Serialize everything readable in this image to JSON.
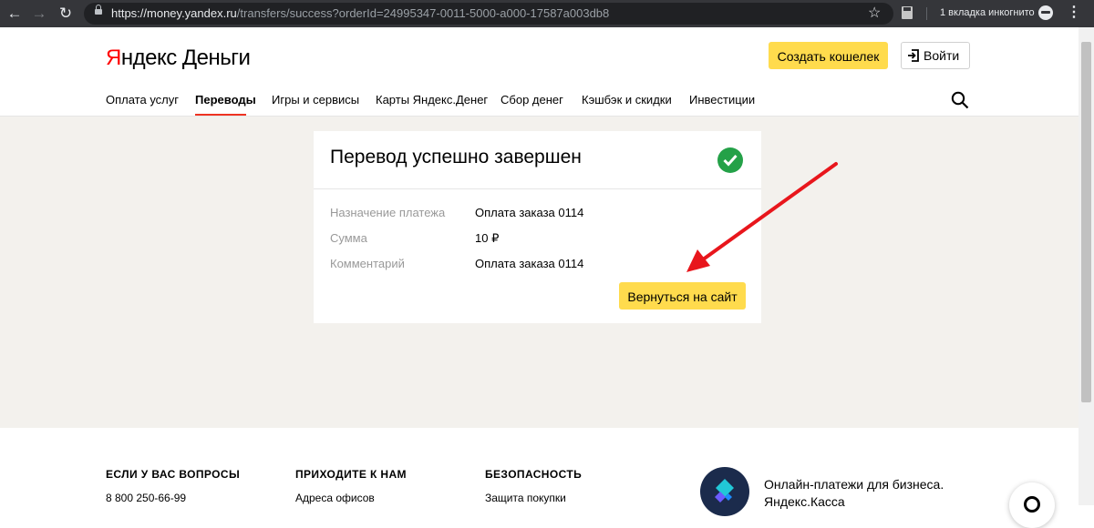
{
  "browser": {
    "url_host": "https://money.yandex.ru",
    "url_path": "/transfers/success?orderId=24995347-0011-5000-a000-17587a003db8",
    "incognito_label": "1 вкладка инкогнито"
  },
  "header": {
    "logo_y": "Я",
    "logo_rest": "ндекс Деньги",
    "create_wallet": "Создать кошелек",
    "login": "Войти",
    "nav": [
      "Оплата услуг",
      "Переводы",
      "Игры и сервисы",
      "Карты Яндекс.Денег",
      "Сбор денег",
      "Кэшбэк и скидки",
      "Инвестиции"
    ],
    "active_nav": "Переводы"
  },
  "card": {
    "title": "Перевод успешно завершен",
    "rows": [
      {
        "label": "Назначение платежа",
        "value": "Оплата заказа 0114"
      },
      {
        "label": "Сумма",
        "value": "10 ₽"
      },
      {
        "label": "Комментарий",
        "value": "Оплата заказа 0114"
      }
    ],
    "back_button": "Вернуться на сайт"
  },
  "footer": {
    "columns": [
      {
        "heading": "ЕСЛИ У ВАС ВОПРОСЫ",
        "link": "8 800 250-66-99"
      },
      {
        "heading": "ПРИХОДИТЕ К НАМ",
        "link": "Адреса офисов"
      },
      {
        "heading": "БЕЗОПАСНОСТЬ",
        "link": "Защита покупки"
      }
    ],
    "promo_line1": "Онлайн-платежи для бизнеса.",
    "promo_line2": "Яндекс.Касса"
  },
  "colors": {
    "accent": "#ffdb4d",
    "success": "#24a148",
    "annotation_arrow": "#e8161c",
    "nav_active": "#e32"
  }
}
